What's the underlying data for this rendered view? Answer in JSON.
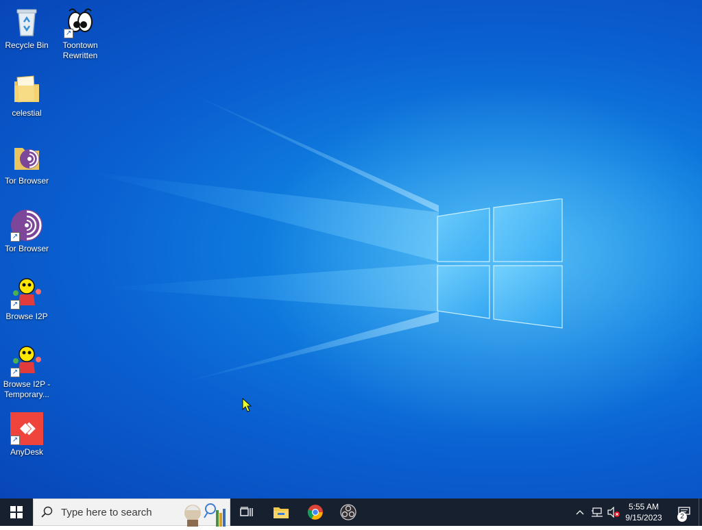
{
  "desktop": {
    "icons": [
      {
        "label": "Recycle Bin",
        "icon": "recycle-bin-icon"
      },
      {
        "label": "Toontown Rewritten",
        "icon": "toontown-icon"
      },
      {
        "label": "celestial",
        "icon": "folder-icon"
      },
      {
        "label": "Tor Browser",
        "icon": "tor-folder-icon"
      },
      {
        "label": "Tor Browser",
        "icon": "tor-browser-icon"
      },
      {
        "label": "Browse I2P",
        "icon": "i2p-icon"
      },
      {
        "label": "Browse I2P - Temporary...",
        "icon": "i2p-icon"
      },
      {
        "label": "AnyDesk",
        "icon": "anydesk-icon"
      }
    ],
    "colors": {
      "wallpaper_accent": "#0f7fe0",
      "taskbar_bg": "#16202e",
      "anydesk_red": "#ef443b",
      "tor_purple": "#7d4698"
    }
  },
  "taskbar": {
    "search_placeholder": "Type here to search",
    "pinned": [
      "task-view",
      "file-explorer",
      "chrome",
      "obs-studio"
    ],
    "clock_time": "5:55 AM",
    "clock_date": "9/15/2023",
    "notification_count": "2"
  }
}
